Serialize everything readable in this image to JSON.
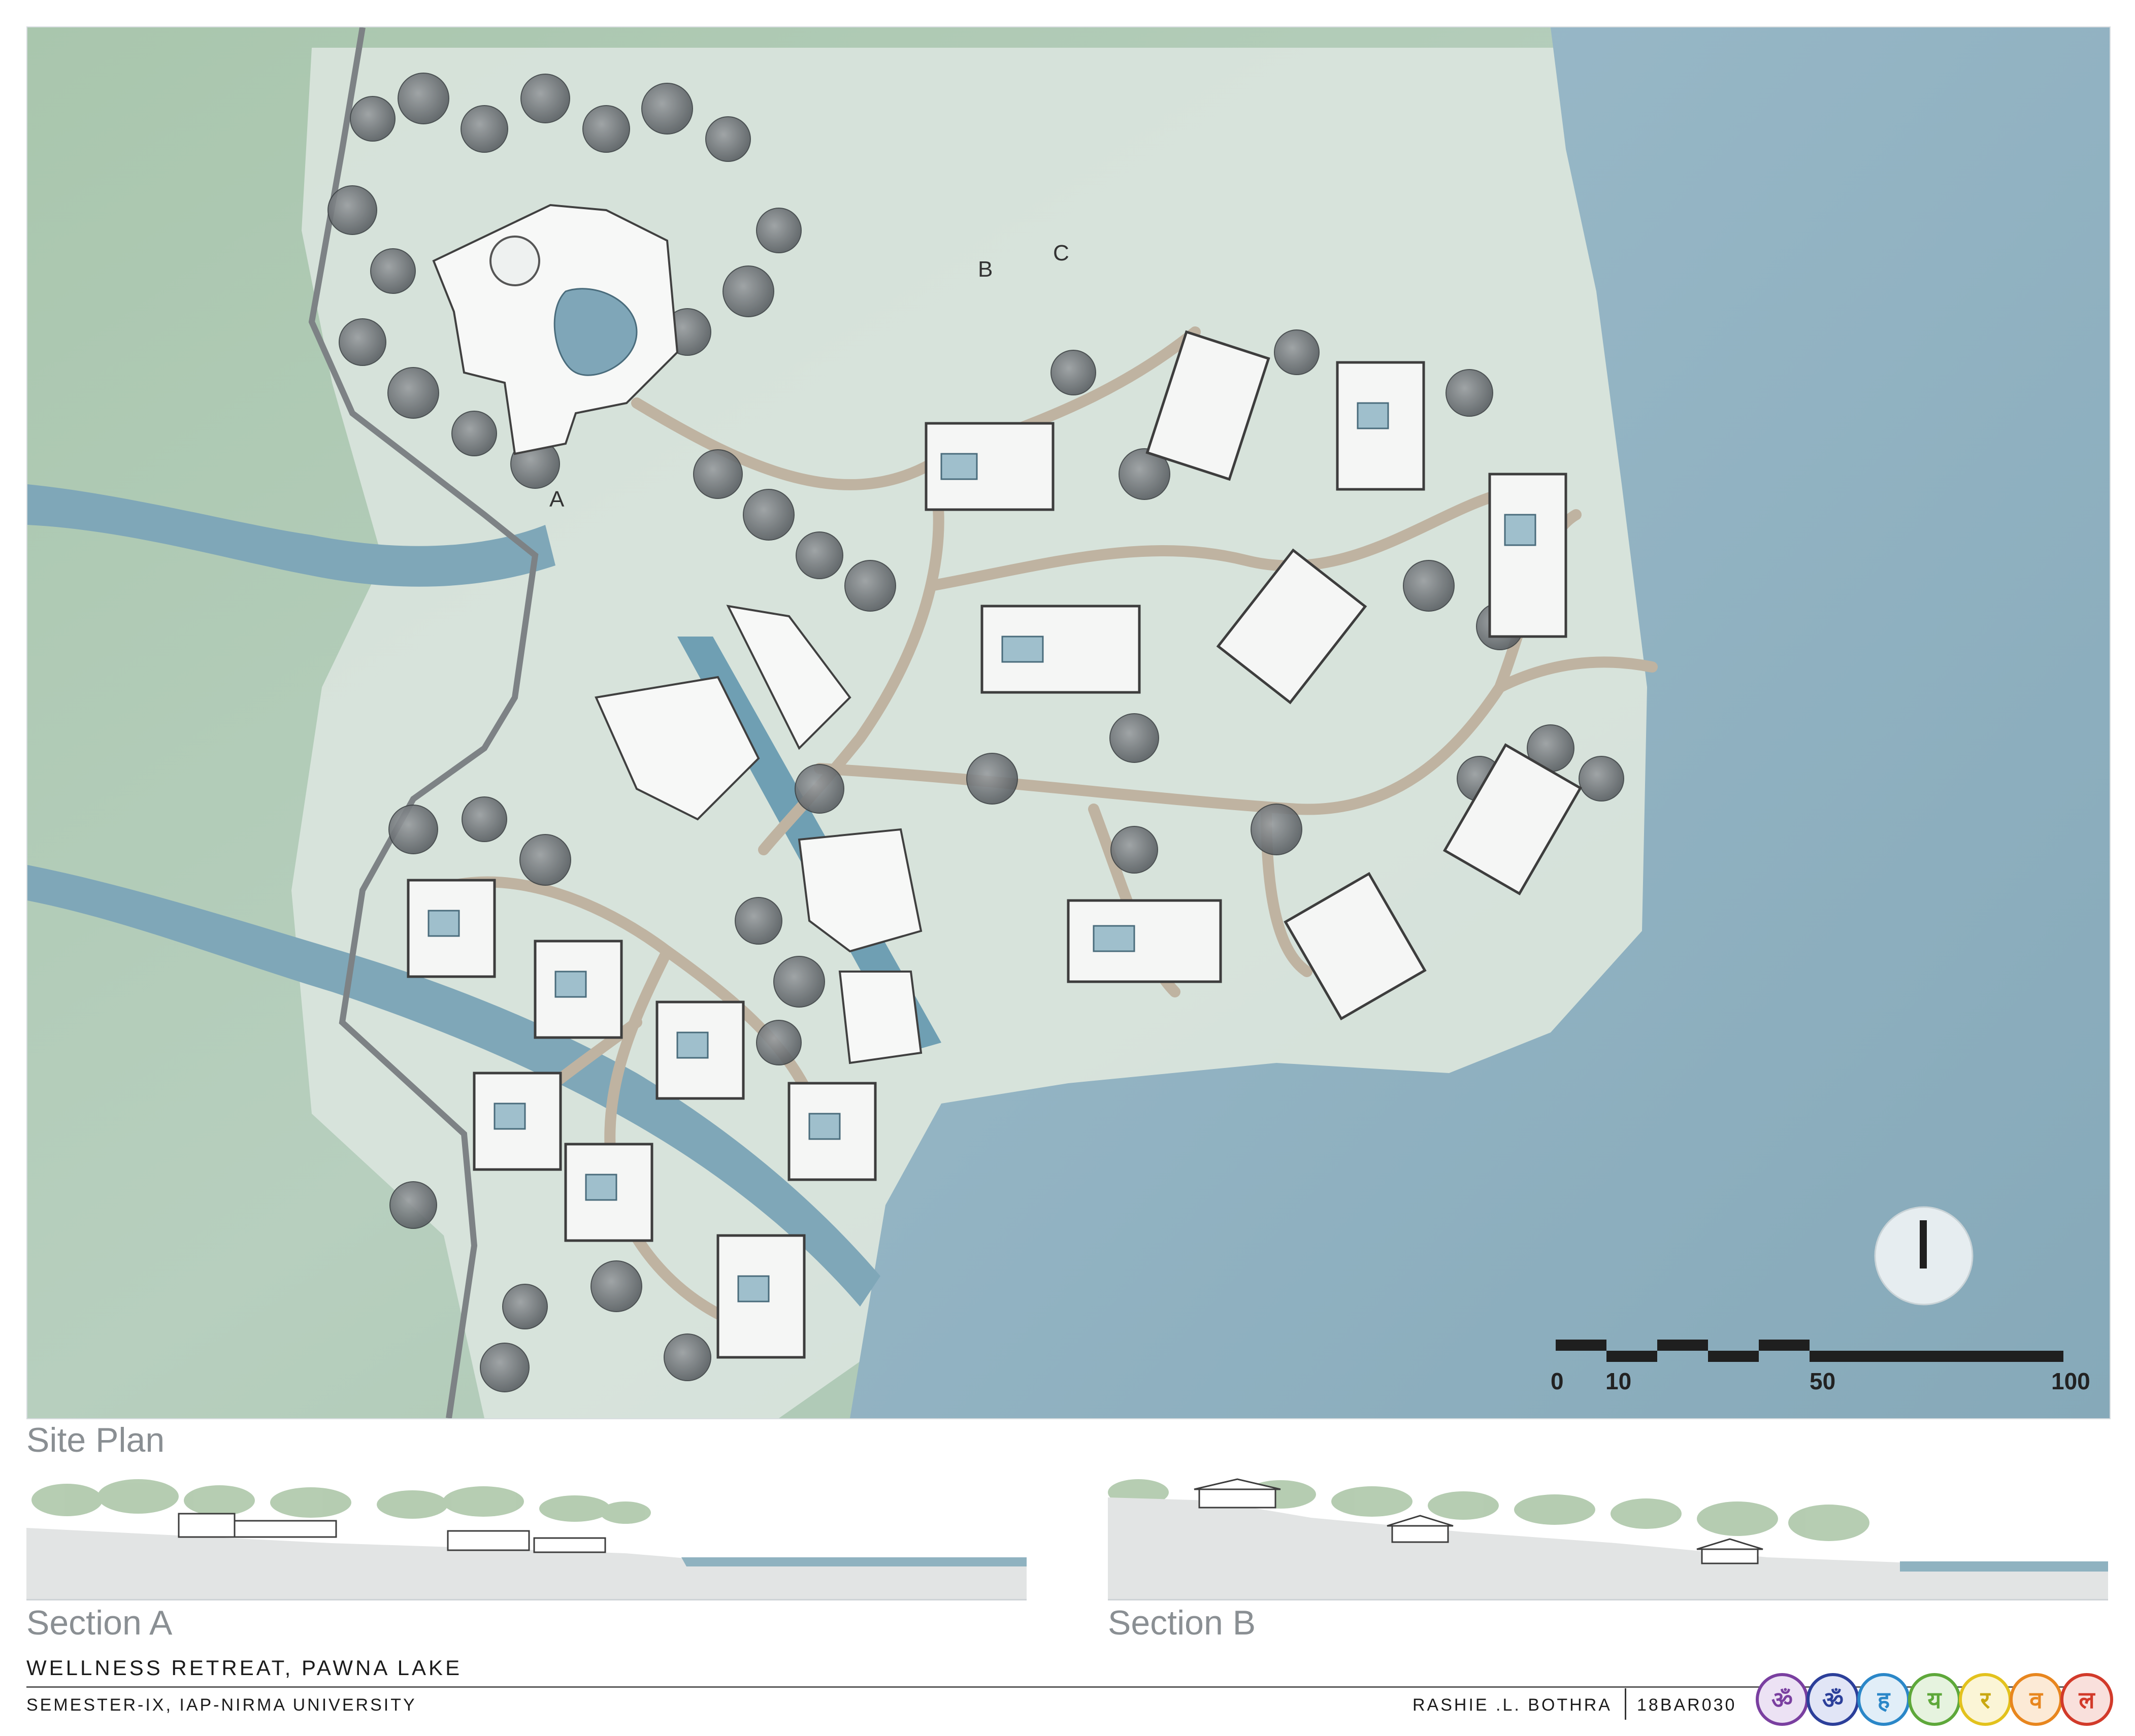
{
  "drawing": {
    "section_markers": {
      "a": "A",
      "b": "B",
      "c": "C"
    },
    "scale_labels": [
      "0",
      "10",
      "50",
      "100"
    ],
    "north_arrow": "north-arrow-icon"
  },
  "views": {
    "site_plan": "Site Plan",
    "section_a": "Section A",
    "section_b": "Section B"
  },
  "footer": {
    "title": "WELLNESS RETREAT, PAWNA LAKE",
    "subtitle": "SEMESTER-IX, IAP-NIRMA UNIVERSITY",
    "author": "RASHIE .L. BOTHRA",
    "student_id": "18BAR030"
  },
  "chakra_icons": [
    {
      "name": "crown-chakra-icon",
      "color": "#7a3fa0"
    },
    {
      "name": "third-eye-chakra-icon",
      "color": "#2c3f9a"
    },
    {
      "name": "throat-chakra-icon",
      "color": "#2b87c8"
    },
    {
      "name": "heart-chakra-icon",
      "color": "#5ea83a"
    },
    {
      "name": "solar-plexus-chakra-icon",
      "color": "#e3c21d"
    },
    {
      "name": "sacral-chakra-icon",
      "color": "#e8861e"
    },
    {
      "name": "root-chakra-icon",
      "color": "#d23a2a"
    }
  ],
  "palette": {
    "land": "#9fbfa6",
    "lake": "#8fb2c0",
    "river": "#6f9fb3",
    "path": "#bfb3a1",
    "tree": "#6f7478"
  }
}
